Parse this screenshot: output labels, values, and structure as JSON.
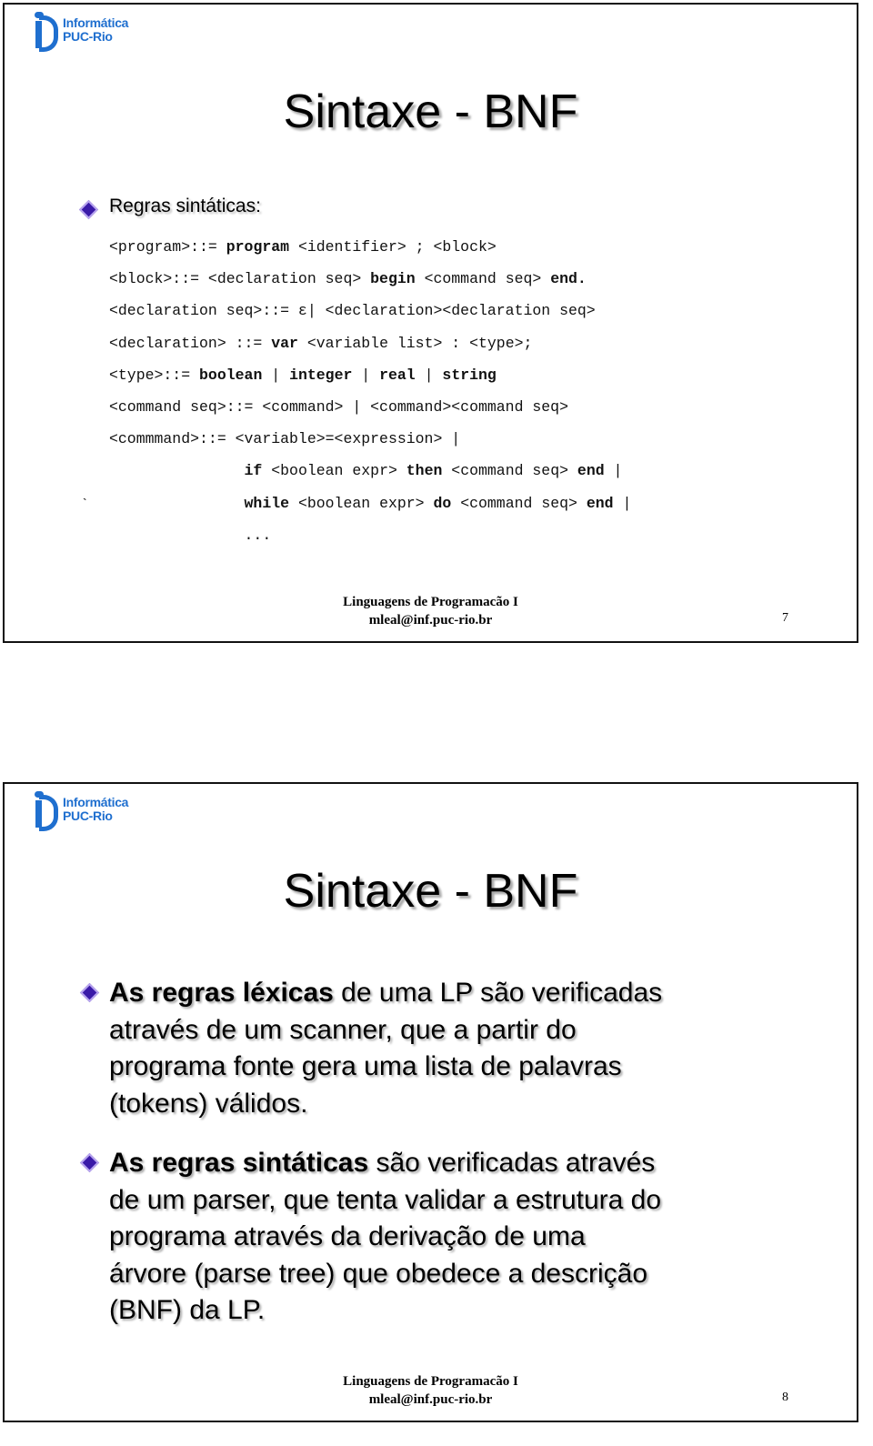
{
  "logo": {
    "line1": "Informática",
    "line2": "PUC-Rio"
  },
  "footer": {
    "course": "Linguagens de Programacão I",
    "email": "mleal@inf.puc-rio.br"
  },
  "slide1": {
    "title": "Sintaxe - BNF",
    "subtitle": "Regras sintáticas:",
    "page_number": "7",
    "stray_mark": "`",
    "code_lines": [
      [
        {
          "t": "<program>::= "
        },
        {
          "t": "program",
          "b": true
        },
        {
          "t": " <identifier> ; <block>"
        }
      ],
      [
        {
          "t": "<block>::= <declaration seq> "
        },
        {
          "t": "begin",
          "b": true
        },
        {
          "t": " <command seq> "
        },
        {
          "t": "end.",
          "b": true
        }
      ],
      [
        {
          "t": "<declaration seq>::= ε| <declaration><declaration seq>"
        }
      ],
      [
        {
          "t": "<declaration> ::= "
        },
        {
          "t": "var",
          "b": true
        },
        {
          "t": " <variable list> : <type>;"
        }
      ],
      [
        {
          "t": "<type>::= "
        },
        {
          "t": "boolean",
          "b": true
        },
        {
          "t": " | "
        },
        {
          "t": "integer",
          "b": true
        },
        {
          "t": " | "
        },
        {
          "t": "real",
          "b": true
        },
        {
          "t": " | "
        },
        {
          "t": "string",
          "b": true
        }
      ],
      [
        {
          "t": "<command seq>::= <command> | <command><command seq>"
        }
      ],
      [
        {
          "t": "<commmand>::= <variable>=<expression> |"
        }
      ],
      [
        {
          "t": "               "
        },
        {
          "t": "if",
          "b": true
        },
        {
          "t": " <boolean expr> "
        },
        {
          "t": "then",
          "b": true
        },
        {
          "t": " <command seq> "
        },
        {
          "t": "end",
          "b": true
        },
        {
          "t": " |"
        }
      ],
      [
        {
          "t": "               "
        },
        {
          "t": "while",
          "b": true
        },
        {
          "t": " <boolean expr> "
        },
        {
          "t": "do",
          "b": true
        },
        {
          "t": " <command seq> "
        },
        {
          "t": "end",
          "b": true
        },
        {
          "t": " |"
        }
      ],
      [
        {
          "t": "               ..."
        }
      ]
    ]
  },
  "slide2": {
    "title": "Sintaxe - BNF",
    "page_number": "8",
    "paragraphs": [
      [
        [
          {
            "t": "As regras léxicas",
            "b": true
          },
          {
            "t": " de uma LP são verificadas"
          }
        ],
        [
          {
            "t": "através de um scanner, que a partir do"
          }
        ],
        [
          {
            "t": "programa fonte gera uma lista de palavras"
          }
        ],
        [
          {
            "t": "(tokens) válidos."
          }
        ]
      ],
      [
        [
          {
            "t": "As regras sintáticas",
            "b": true
          },
          {
            "t": " são verificadas através"
          }
        ],
        [
          {
            "t": "de um parser, que tenta validar a estrutura do"
          }
        ],
        [
          {
            "t": "programa através da derivação de uma"
          }
        ],
        [
          {
            "t": "árvore (parse tree) que obedece a descrição"
          }
        ],
        [
          {
            "t": "(BNF) da LP."
          }
        ]
      ]
    ]
  }
}
